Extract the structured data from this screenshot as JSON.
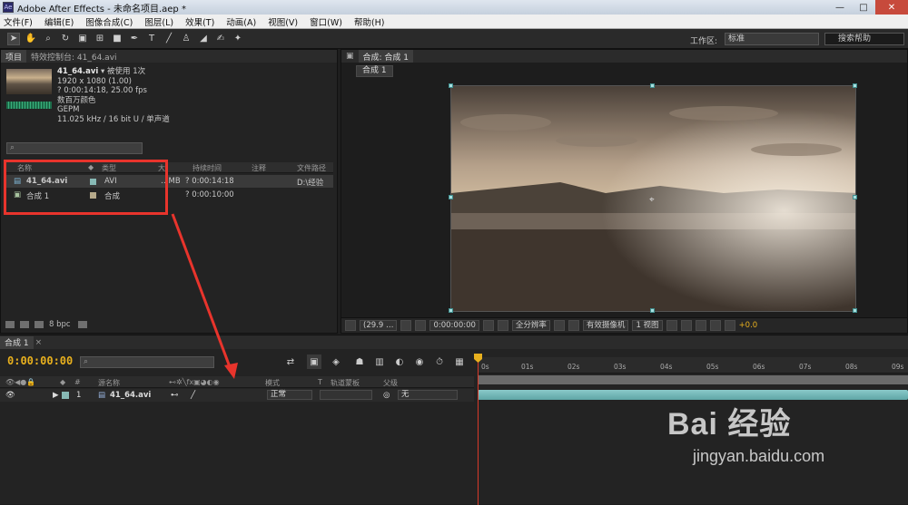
{
  "window": {
    "title": "Adobe After Effects - 未命名项目.aep *",
    "app_icon": "Ae",
    "minimize": "—",
    "maximize": "□",
    "close": "✕"
  },
  "menu": [
    "文件(F)",
    "编辑(E)",
    "图像合成(C)",
    "图层(L)",
    "效果(T)",
    "动画(A)",
    "视图(V)",
    "窗口(W)",
    "帮助(H)"
  ],
  "toolbar": {
    "tools": [
      "arrow-icon",
      "hand-icon",
      "zoom-icon",
      "rotate-icon",
      "camera-icon",
      "pan-icon",
      "rectangle-icon",
      "pen-icon",
      "text-icon",
      "brush-icon",
      "clone-icon",
      "eraser-icon",
      "roto-icon",
      "puppet-icon"
    ],
    "workspace_label": "工作区:",
    "workspace_value": "标准",
    "search_help": "搜索帮助"
  },
  "project": {
    "tab_project": "项目",
    "tab_effects": "特效控制台: 41_64.avi",
    "footage": {
      "name": "41_64.avi",
      "usage": "▾ 被使用 1次",
      "dims": "1920 x 1080 (1.00)",
      "duration": "? 0:00:14:18, 25.00 fps",
      "colors": "数百万颜色",
      "codec": "GEPM",
      "audio": "11.025 kHz / 16 bit U / 单声道"
    },
    "search_placeholder": "",
    "columns": {
      "name": "名称",
      "type": "类型",
      "size": "大",
      "duration": "持续时间",
      "comment": "注释",
      "path": "文件路径"
    },
    "rows": [
      {
        "name": "41_64.avi",
        "type": "AVI",
        "size": "…MB",
        "duration": "? 0:00:14:18",
        "path": "D:\\经验"
      },
      {
        "name": "合成 1",
        "type": "合成",
        "size": "",
        "duration": "? 0:00:10:00",
        "path": ""
      }
    ],
    "colors": {
      "avi": "#87b9b5",
      "comp": "#b5a98a"
    },
    "footer_bpc": "8 bpc"
  },
  "composition": {
    "tab": "合成: 合成 1",
    "subtab": "合成 1",
    "controls": {
      "zoom": "(29.9 …",
      "timecode": "0:00:00:00",
      "resolution": "全分辨率",
      "camera": "有效摄像机",
      "view": "1 视图",
      "exposure": "+0.0"
    }
  },
  "timeline": {
    "tab": "合成 1",
    "timecode": "0:00:00:00",
    "search_placeholder": "",
    "header": {
      "layer_name": "源名称",
      "mode": "模式",
      "t": "T",
      "trkmat": "轨道蒙板",
      "parent": "父级"
    },
    "layer": {
      "index": "1",
      "name": "41_64.avi",
      "mode": "正常",
      "parent": "无"
    },
    "ruler_ticks": [
      "0s",
      "01s",
      "02s",
      "03s",
      "04s",
      "05s",
      "06s",
      "07s",
      "08s",
      "09s"
    ],
    "track_color": "#7bbcbc"
  },
  "watermark": {
    "brand": "Bai 经验",
    "url": "jingyan.baidu.com"
  }
}
